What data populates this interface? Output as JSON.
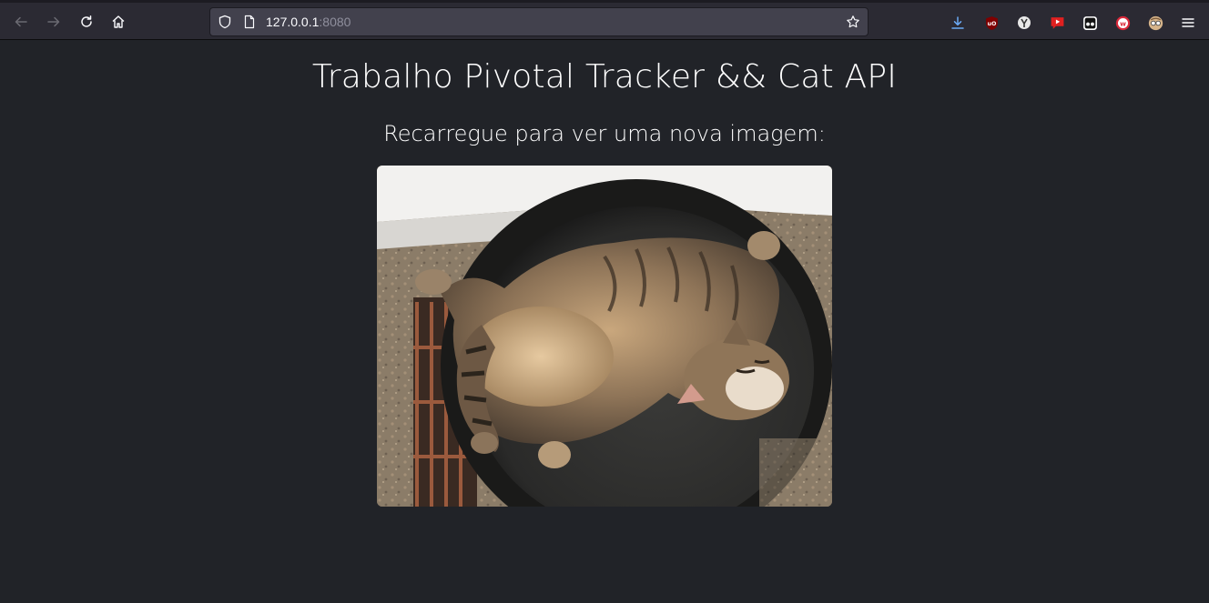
{
  "browser": {
    "url_host": "127.0.0.1",
    "url_port": ":8080",
    "icons": {
      "back": "back-arrow-icon",
      "forward": "forward-arrow-icon",
      "reload": "reload-icon",
      "home": "home-icon",
      "tracking_protection": "shield-icon",
      "page_info": "page-icon",
      "bookmark": "star-icon",
      "downloads": "download-icon",
      "menu": "hamburger-menu-icon"
    },
    "extensions": [
      "ublock-origin-icon",
      "extension-icon",
      "youtube-extension-icon",
      "reader-extension-icon",
      "w-extension-icon",
      "avatar-extension-icon"
    ]
  },
  "page": {
    "title": "Trabalho Pivotal Tracker && Cat API",
    "subtitle": "Recarregue para ver uma nova imagem:",
    "image_alt": "cat sleeping in round basin"
  },
  "colors": {
    "page_bg": "#212328",
    "toolbar_bg": "#2b2a33",
    "urlbar_bg": "#42414d",
    "text": "#ffffff"
  }
}
